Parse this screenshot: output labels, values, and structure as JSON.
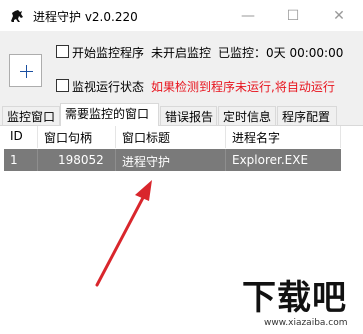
{
  "window": {
    "title": "进程守护 v2.0.220",
    "controls": {
      "minimize": "—",
      "maximize": "☐",
      "close": "✕"
    }
  },
  "options": {
    "start_monitor_label": "开始监控程序",
    "monitor_status": "未开启监控",
    "monitored_time": "已监控：0天 00:00:00",
    "monitor_run_status_label": "监视运行状态",
    "auto_run_hint": "如果检测到程序未运行,将自动运行"
  },
  "tabs": [
    {
      "label": "监控窗口",
      "active": false
    },
    {
      "label": "需要监控的窗口",
      "active": true
    },
    {
      "label": "错误报告",
      "active": false
    },
    {
      "label": "定时信息",
      "active": false
    },
    {
      "label": "程序配置",
      "active": false
    }
  ],
  "table": {
    "columns": [
      "ID",
      "窗口句柄",
      "窗口标题",
      "进程名字"
    ],
    "rows": [
      {
        "id": "1",
        "handle": "198052",
        "title": "进程守护",
        "process": "Explorer.EXE"
      }
    ]
  },
  "watermark": {
    "text": "下载吧",
    "url": "www.xiazaiba.com"
  },
  "colors": {
    "selected_row": "#7a7a7a",
    "annotation_arrow": "#d9262c",
    "hint_red": "#e8141e",
    "client_bg": "#f0f0f0"
  }
}
